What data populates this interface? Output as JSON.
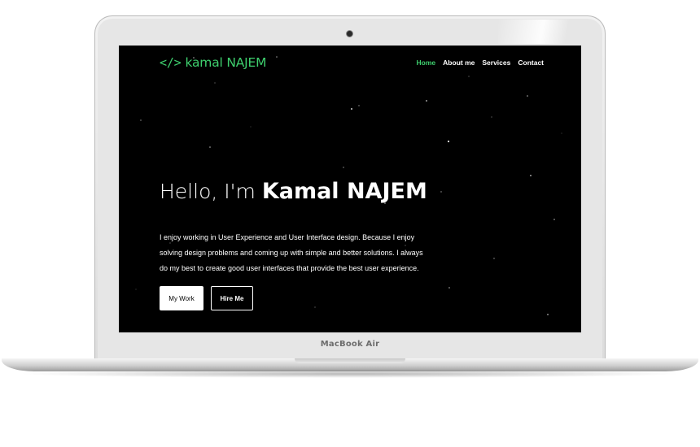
{
  "device": {
    "label": "MacBook Air"
  },
  "site": {
    "logo_icon": "</>",
    "logo_text": "kamal NAJEM",
    "accent_color": "#3ecf6e",
    "background_color": "#000000"
  },
  "nav": {
    "items": [
      {
        "label": "Home",
        "active": true
      },
      {
        "label": "About me",
        "active": false
      },
      {
        "label": "Services",
        "active": false
      },
      {
        "label": "Contact",
        "active": false
      }
    ]
  },
  "hero": {
    "greeting": "Hello, I'm",
    "name": "Kamal NAJEM",
    "description": "I enjoy working in User Experience and User Interface design. Because I enjoy solving design problems and coming up with simple and better solutions. I always do my best to create good user interfaces that provide the best user experience.",
    "primary_button": "My Work",
    "secondary_button": "Hire Me"
  }
}
